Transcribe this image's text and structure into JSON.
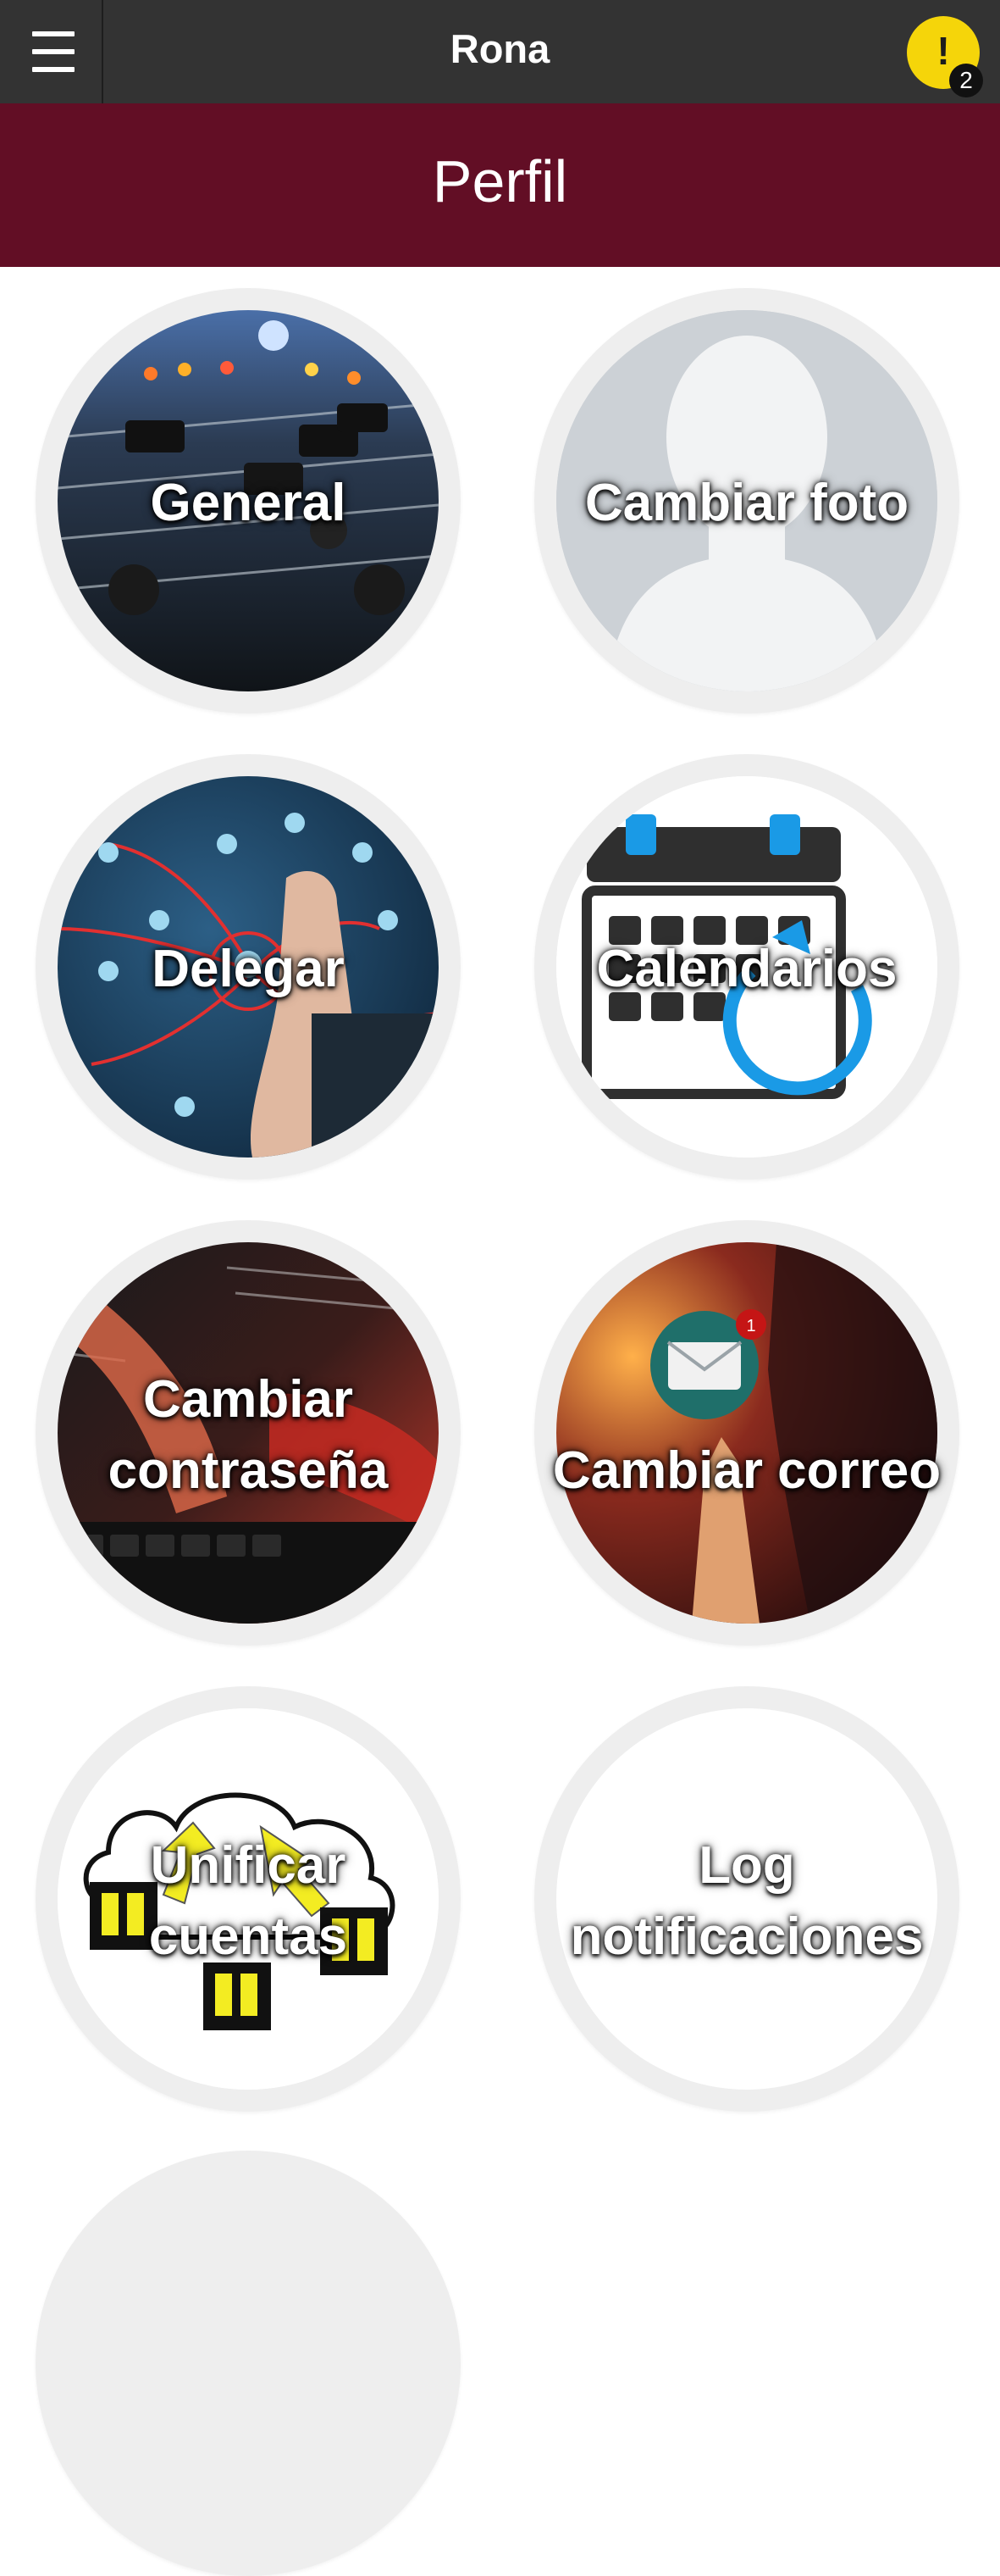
{
  "app": {
    "title": "Rona"
  },
  "notifications": {
    "count": "2",
    "glyph": "!"
  },
  "header": {
    "title": "Perfil"
  },
  "tiles": [
    {
      "id": "general",
      "label": "General",
      "image": "audio-mixer-photo"
    },
    {
      "id": "cambiar-foto",
      "label": "Cambiar foto",
      "image": "profile-silhouette"
    },
    {
      "id": "delegar",
      "label": "Delegar",
      "image": "network-diagram-photo"
    },
    {
      "id": "calendarios",
      "label": "Calendarios",
      "image": "calendar-sync-icon"
    },
    {
      "id": "cambiar-contrasena",
      "label": "Cambiar\ncontraseña",
      "image": "keyboard-typing-photo"
    },
    {
      "id": "cambiar-correo",
      "label": "Cambiar correo",
      "image": "email-touch-photo",
      "badge": "1"
    },
    {
      "id": "unificar-cuentas",
      "label": "Unificar\ncuentas",
      "image": "merge-accounts-cloud-icon"
    },
    {
      "id": "log-notificaciones",
      "label": "Log\nnotificaciones",
      "image": "blank"
    }
  ],
  "colors": {
    "topbar": "#333333",
    "header": "#620e25",
    "alert": "#f5d50a",
    "ring": "#eeeeee"
  }
}
